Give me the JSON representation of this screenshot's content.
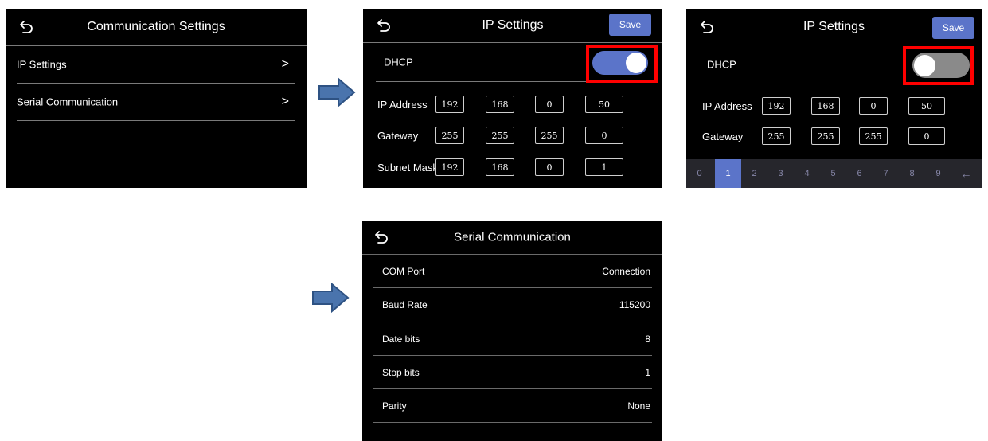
{
  "screen1": {
    "title": "Communication Settings",
    "items": [
      {
        "label": "IP Settings",
        "chevron": ">"
      },
      {
        "label": "Serial Communication",
        "chevron": ">"
      }
    ]
  },
  "screen2": {
    "title": "IP Settings",
    "save_label": "Save",
    "dhcp_label": "DHCP",
    "dhcp_on": true,
    "ip_label": "IP Address",
    "ip": [
      "192",
      "168",
      "0",
      "50"
    ],
    "gateway_label": "Gateway",
    "gateway": [
      "255",
      "255",
      "255",
      "0"
    ],
    "subnet_label": "Subnet Mask",
    "subnet": [
      "192",
      "168",
      "0",
      "1"
    ]
  },
  "screen3": {
    "title": "IP Settings",
    "save_label": "Save",
    "dhcp_label": "DHCP",
    "dhcp_on": false,
    "ip_label": "IP Address",
    "ip": [
      "192",
      "168",
      "0",
      "50"
    ],
    "gateway_label": "Gateway",
    "gateway": [
      "255",
      "255",
      "255",
      "0"
    ],
    "keypad": [
      "0",
      "1",
      "2",
      "3",
      "4",
      "5",
      "6",
      "7",
      "8",
      "9",
      "←"
    ],
    "keypad_selected": "1"
  },
  "screen4": {
    "title": "Serial Communication",
    "rows": [
      {
        "label": "COM Port",
        "value": "Connection"
      },
      {
        "label": "Baud Rate",
        "value": "115200"
      },
      {
        "label": "Date bits",
        "value": "8"
      },
      {
        "label": "Stop bits",
        "value": "1"
      },
      {
        "label": "Parity",
        "value": "None"
      }
    ]
  },
  "colors": {
    "accent": "#5b74c9",
    "highlight": "#ff0000",
    "arrow": "#4a74ad",
    "toggle_off": "#8a8a8a"
  },
  "icons": [
    "back-icon",
    "chevron-right-icon",
    "arrow-right-icon"
  ]
}
